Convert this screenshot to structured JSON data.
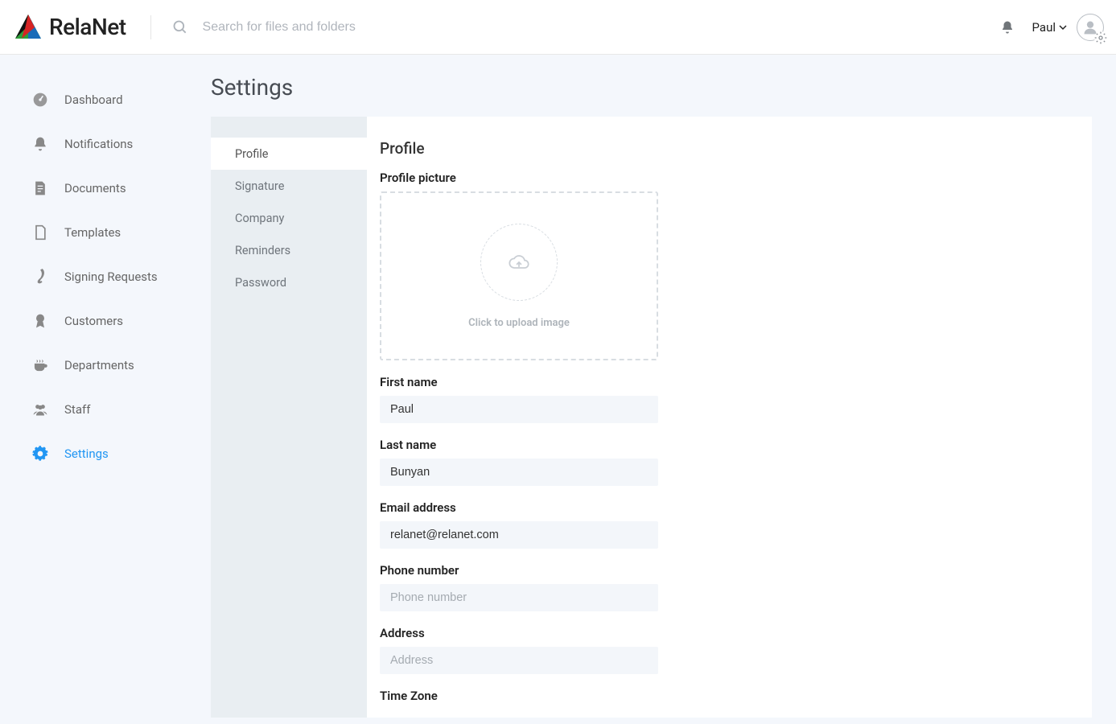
{
  "brand": "RelaNet",
  "search": {
    "placeholder": "Search for files and folders"
  },
  "user": {
    "name": "Paul"
  },
  "sidebar": {
    "items": [
      {
        "label": "Dashboard",
        "icon": "gauge-icon"
      },
      {
        "label": "Notifications",
        "icon": "bell-icon"
      },
      {
        "label": "Documents",
        "icon": "document-icon"
      },
      {
        "label": "Templates",
        "icon": "template-icon"
      },
      {
        "label": "Signing Requests",
        "icon": "signature-icon"
      },
      {
        "label": "Customers",
        "icon": "award-icon"
      },
      {
        "label": "Departments",
        "icon": "coffee-icon"
      },
      {
        "label": "Staff",
        "icon": "people-icon"
      },
      {
        "label": "Settings",
        "icon": "gear-icon"
      }
    ],
    "activeIndex": 8
  },
  "page": {
    "title": "Settings",
    "tabs": [
      "Profile",
      "Signature",
      "Company",
      "Reminders",
      "Password"
    ],
    "activeTab": 0
  },
  "profile": {
    "section_title": "Profile",
    "picture_label": "Profile picture",
    "upload_text": "Click to upload image",
    "first_name": {
      "label": "First name",
      "value": "Paul"
    },
    "last_name": {
      "label": "Last name",
      "value": "Bunyan"
    },
    "email": {
      "label": "Email address",
      "value": "relanet@relanet.com"
    },
    "phone": {
      "label": "Phone number",
      "value": "",
      "placeholder": "Phone number"
    },
    "address": {
      "label": "Address",
      "value": "",
      "placeholder": "Address"
    },
    "timezone": {
      "label": "Time Zone"
    }
  }
}
